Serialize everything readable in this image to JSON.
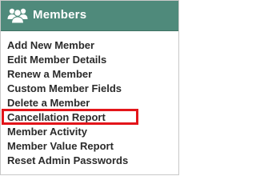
{
  "header": {
    "title": "Members",
    "icon": "users-icon",
    "background_color": "#4f8a7b"
  },
  "menu": {
    "items": [
      {
        "label": "Add New Member"
      },
      {
        "label": "Edit Member Details"
      },
      {
        "label": "Renew a Member"
      },
      {
        "label": "Custom Member Fields"
      },
      {
        "label": "Delete a Member"
      },
      {
        "label": "Cancellation Report",
        "highlighted": true
      },
      {
        "label": "Member Activity"
      },
      {
        "label": "Member Value Report"
      },
      {
        "label": "Reset Admin Passwords"
      }
    ],
    "highlight_color": "#e3151a"
  }
}
